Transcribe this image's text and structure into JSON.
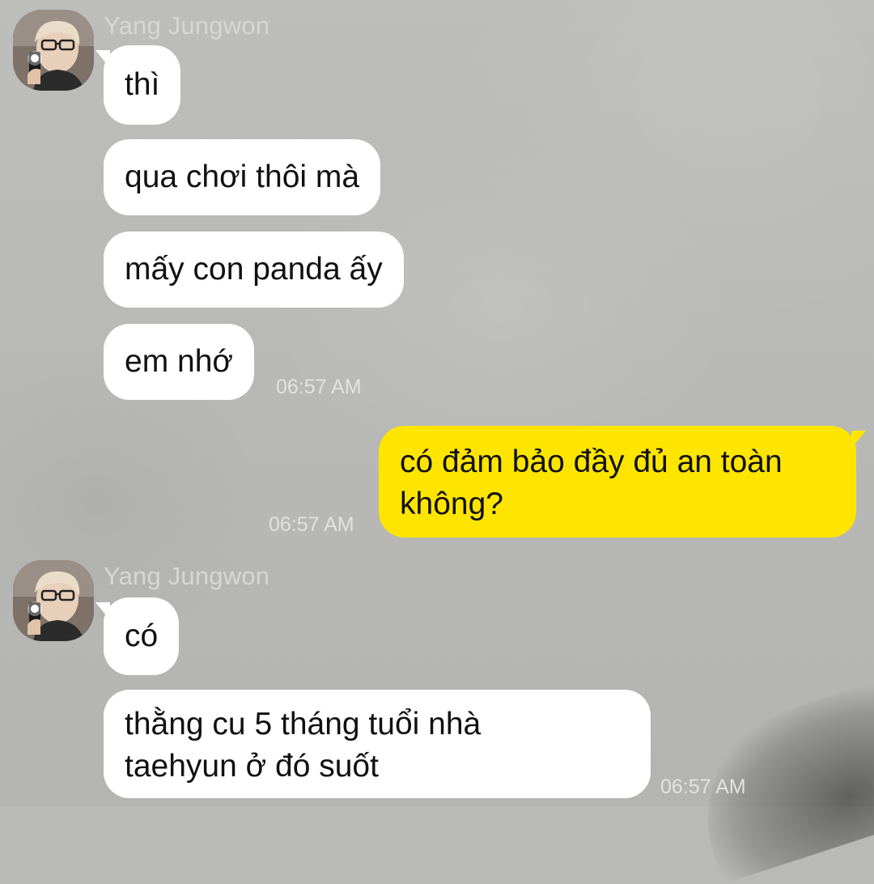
{
  "chat": {
    "sender_name": "Yang Jungwon",
    "colors": {
      "incoming_bubble": "#ffffff",
      "outgoing_bubble": "#fee500",
      "text": "#111111",
      "meta_text": "#d6d6d4"
    },
    "groups": [
      {
        "sender": "Yang Jungwon",
        "messages": [
          {
            "text": "thì"
          },
          {
            "text": "qua chơi thôi mà"
          },
          {
            "text": "mấy con panda ấy"
          },
          {
            "text": "em nhớ",
            "time": "06:57 AM"
          }
        ]
      },
      {
        "sender": "me",
        "messages": [
          {
            "text": "có đảm bảo đầy đủ an toàn\nkhông?",
            "time": "06:57 AM"
          }
        ]
      },
      {
        "sender": "Yang Jungwon",
        "messages": [
          {
            "text": "có"
          },
          {
            "text": "thằng cu 5 tháng tuổi nhà\ntaehyun ở đó suốt",
            "time": "06:57 AM"
          }
        ]
      }
    ]
  }
}
